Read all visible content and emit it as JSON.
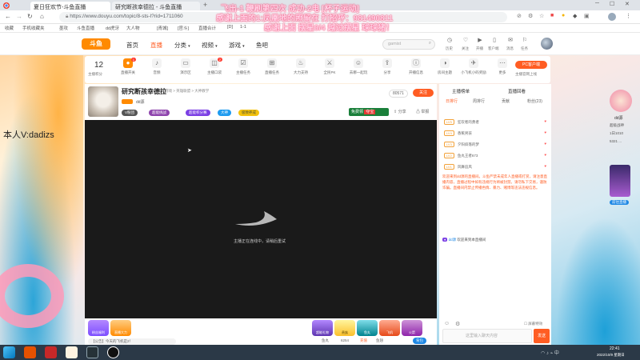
{
  "browser": {
    "tabs": [
      {
        "label": "夏日狂欢节-斗鱼直播"
      },
      {
        "label": "研究断孩幸德拉 - 斗鱼直播"
      }
    ],
    "url": "https://www.douyu.com/topic/8-sts-l?rid=1711060",
    "bookmarks": [
      "收藏",
      "手机收藏夹",
      "墨攻",
      "斗鱼直播",
      "dd虎牙",
      "大人物",
      "[青城]",
      "[官斗]",
      "直播合计",
      "[D]",
      "1-1"
    ]
  },
  "danmaku": [
    "飞出-1 鞭刷第四次 成功-2电 [杯子运动]",
    "感谢上面的1:凤凰地的照留在 打招呼：981490811",
    "感谢上面 摆星0/4  越过摆星 球球猪！"
  ],
  "side_text": "本人V:dadizs",
  "site_header": {
    "logo": "斗鱼",
    "nav": [
      "首页",
      "直播",
      "分类",
      "视频",
      "游戏",
      "鱼吧"
    ],
    "active_nav": "直播",
    "search_placeholder": "gamist",
    "icons": [
      {
        "icon": "history-icon",
        "label": "历史"
      },
      {
        "icon": "follow-icon",
        "label": "关注"
      },
      {
        "icon": "live-icon",
        "label": "开播"
      },
      {
        "icon": "phone-icon",
        "label": "客户端"
      },
      {
        "icon": "message-icon",
        "label": "消息"
      },
      {
        "icon": "task-icon",
        "label": "任务"
      }
    ]
  },
  "activity_bar": {
    "count": "12",
    "count_label": "主播积分",
    "items": [
      "直播开关",
      "音频",
      "演示区",
      "主播口袋",
      "主播任务",
      "直播任务",
      "大力支持",
      "全民PK",
      "去哪一起玩",
      "分享",
      "开播信息",
      "房间主题",
      "小飞机小码奖励",
      "更多"
    ],
    "pc_btn": "PC客户端",
    "pc_sub": "主播官网上线"
  },
  "room": {
    "title": "研究断孩幸德拉",
    "category": "游戏 > 英雄联盟 > 大神教学",
    "streamer": "dd源",
    "follow_count": "80571",
    "follow_btn": "关注",
    "share": "分享",
    "report": "举报",
    "tags": [
      "V粉团",
      "超能挑战",
      "超能积分赛",
      "大神",
      "极致养成"
    ],
    "badges": [
      "免费领",
      "夺宝"
    ],
    "loading_text": "主播正在连线中，请稍后重试"
  },
  "gift_bar": {
    "left_items": [
      "粉丝福利",
      "直播大力"
    ],
    "right_items": [
      "超能礼物",
      "贵族",
      "鱼丸",
      "飞机",
      "火箭"
    ],
    "bottom_items": [
      "鱼丸",
      "6254",
      "充值",
      "鱼翅",
      "背包"
    ],
    "notice": "【公告】今天的飞机是2！"
  },
  "chat": {
    "tabs": [
      "主播榜单",
      "直播回看"
    ],
    "subtabs": [
      "日排行",
      "周排行",
      "贡献",
      "粉丝(23)"
    ],
    "ranks": [
      {
        "level": "LV5",
        "name": "狂欢者的勇者"
      },
      {
        "level": "LV4",
        "name": "香蕉男孩"
      },
      {
        "level": "LV3",
        "name": "夕阳斜落的梦"
      },
      {
        "level": "LV2",
        "name": "鱼丸王者673"
      },
      {
        "level": "LV1",
        "name": "风舞追风"
      }
    ],
    "system_msg": "欢迎来到dd源的直播间。斗鱼严禁未成年人直播或打赏，请注意直播内容，直播过程中如有违规行为将被封禁。请勿私下交易，谨防诈骗。直播间内禁止传播色情、暴力、赌博等违法违规信息。",
    "user_msg_name": "dd源",
    "user_msg_text": "欢迎来到本直播间",
    "input_placeholder": "这里输入聊天内容",
    "send_btn": "发送",
    "checkbox_label": "屏蔽特效"
  },
  "right_widget": {
    "name": "dd源",
    "lines": [
      "超级战神",
      "1日1010",
      "5321 ..."
    ],
    "btn": "前往直播"
  },
  "taskbar": {
    "time": "22:41",
    "date": "2022/10/9 星期日"
  },
  "colors": {
    "accent": "#ff5d23",
    "chrome": "#dfe3e8",
    "taskbar": "#2b3947",
    "video_bg": "#1a1a1a",
    "danmaku": "#ffd4e6"
  }
}
